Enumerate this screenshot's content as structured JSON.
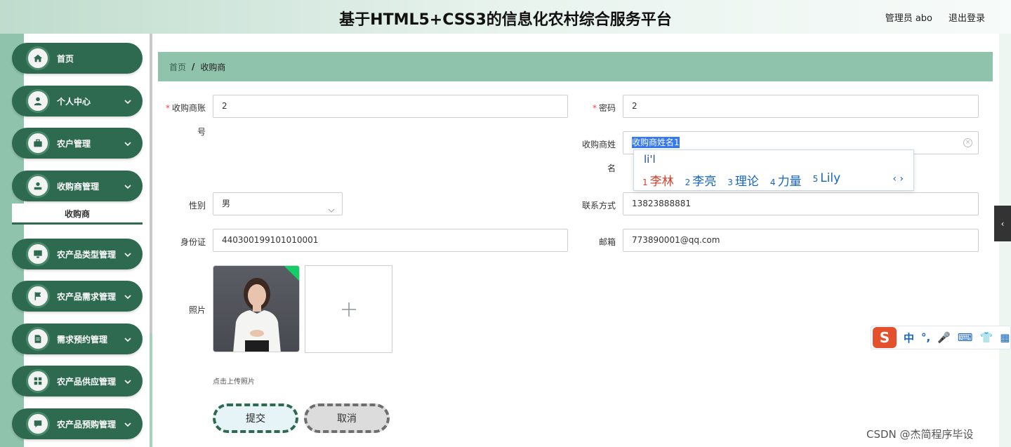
{
  "header": {
    "title": "基于HTML5+CSS3的信息化农村综合服务平台",
    "user": "管理员 abo",
    "logout": "退出登录"
  },
  "sidebar": {
    "items": [
      {
        "label": "首页",
        "icon": "home-icon",
        "chevron": false
      },
      {
        "label": "个人中心",
        "icon": "user-icon",
        "chevron": true
      },
      {
        "label": "农户管理",
        "icon": "briefcase-icon",
        "chevron": true
      },
      {
        "label": "收购商管理",
        "icon": "user-badge-icon",
        "chevron": true
      },
      {
        "label": "农产品类型管理",
        "icon": "monitor-icon",
        "chevron": true
      },
      {
        "label": "农产品需求管理",
        "icon": "flag-icon",
        "chevron": true
      },
      {
        "label": "需求预约管理",
        "icon": "document-icon",
        "chevron": true
      },
      {
        "label": "农产品供应管理",
        "icon": "grid-icon",
        "chevron": true
      },
      {
        "label": "农产品预购管理",
        "icon": "chat-icon",
        "chevron": true
      }
    ],
    "submenu": "收购商"
  },
  "breadcrumb": {
    "home": "首页",
    "separator": "/",
    "current": "收购商"
  },
  "form": {
    "account_label": "收购商账",
    "account_label2": "号",
    "account_value": "2",
    "password_label": "密码",
    "password_value": "2",
    "name_label": "收购商姓",
    "name_label2": "名",
    "name_value": "收购商姓名1",
    "gender_label": "性别",
    "gender_value": "男",
    "phone_label": "联系方式",
    "phone_value": "13823888881",
    "id_label": "身份证",
    "id_value": "440300199101010001",
    "email_label": "邮箱",
    "email_value": "773890001@qq.com",
    "photo_label": "照片",
    "upload_tip": "点击上传照片",
    "submit": "提交",
    "cancel": "取消"
  },
  "ime": {
    "pinyin": "li'l",
    "candidates": [
      {
        "n": "1",
        "text": "李林"
      },
      {
        "n": "2",
        "text": "李亮"
      },
      {
        "n": "3",
        "text": "理论"
      },
      {
        "n": "4",
        "text": "力量"
      },
      {
        "n": "5",
        "text": "Lily"
      }
    ],
    "bar_mode": "中"
  },
  "watermark": "CSDN @杰简程序毕设",
  "colors": {
    "primary": "#2d6a4f",
    "breadcrumb_bg": "#8fc3ab",
    "required": "#ee4444"
  }
}
